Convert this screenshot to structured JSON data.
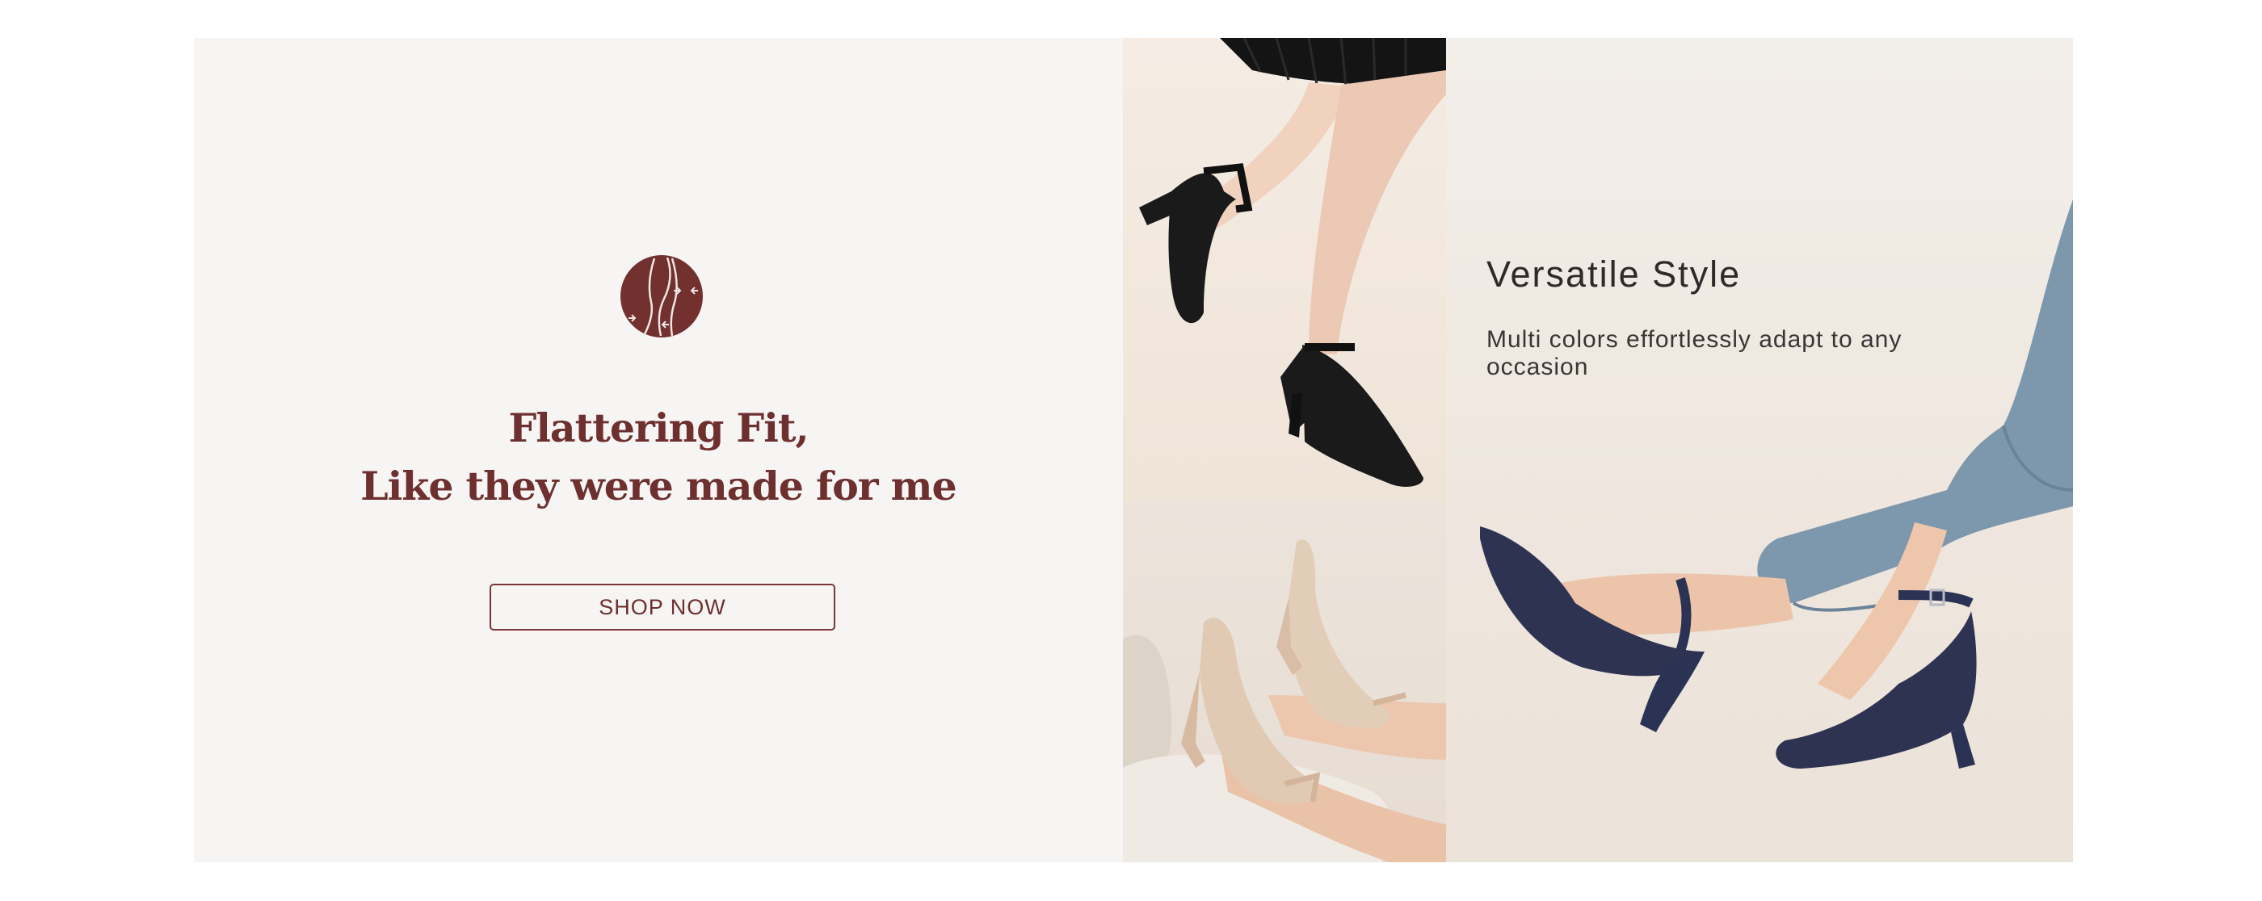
{
  "promo": {
    "icon": "fitted-legs-icon",
    "headline_line1": "Flattering Fit,",
    "headline_line2": "Like they were made for me",
    "cta_label": "SHOP NOW"
  },
  "feature": {
    "title": "Versatile Style",
    "subtitle": "Multi colors effortlessly adapt to any occasion"
  },
  "photos": {
    "top": "black-tweed-heels-photo",
    "bottom": "beige-tweed-heels-photo",
    "feature": "navy-tweed-heels-photo"
  },
  "colors": {
    "brand": "#6e2f2f",
    "panel_bg": "#f7f5f3",
    "text_dark": "#2e2a2a"
  }
}
